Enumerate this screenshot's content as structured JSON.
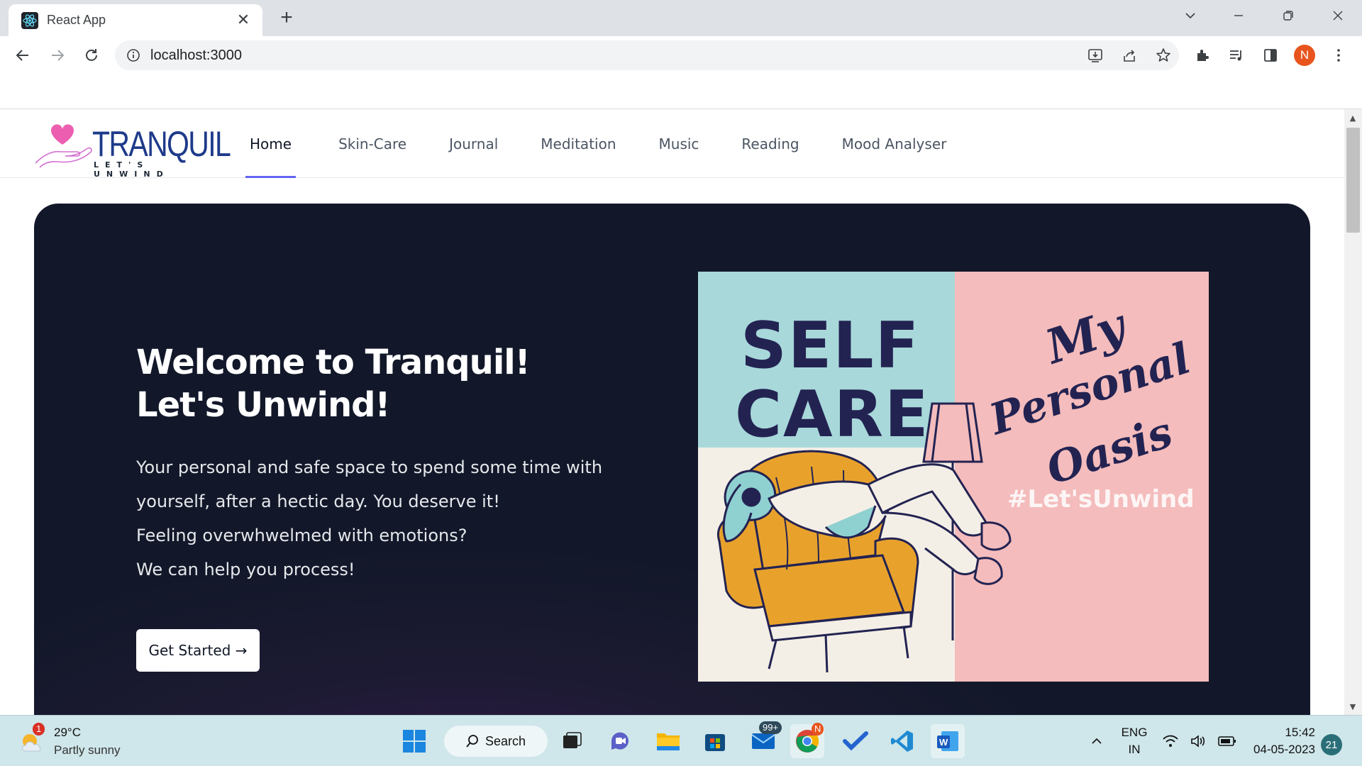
{
  "browser": {
    "tab_title": "React App",
    "url": "localhost:3000",
    "profile_initial": "N"
  },
  "site": {
    "logo_word": "TRANQUIL",
    "logo_tagline": "LET'S UNWIND",
    "nav": [
      {
        "label": "Home",
        "active": true
      },
      {
        "label": "Skin-Care"
      },
      {
        "label": "Journal"
      },
      {
        "label": "Meditation"
      },
      {
        "label": "Music"
      },
      {
        "label": "Reading"
      },
      {
        "label": "Mood Analyser"
      }
    ]
  },
  "hero": {
    "title_line1": "Welcome to Tranquil!",
    "title_line2": "Let's Unwind!",
    "copy": [
      "Your personal and safe space to spend some time with",
      "yourself, after a hectic day. You deserve it!",
      "Feeling overwhwelmed with emotions?",
      "We can help you process!"
    ],
    "cta_label": "Get Started →",
    "image": {
      "self": "SELF",
      "care": "CARE",
      "script_line1": "My",
      "script_line2": "Personal",
      "script_line3": "Oasis",
      "hashtag": "#Let'sUnwind",
      "colors": {
        "teal": "#a8d8da",
        "pink": "#f4bcbc",
        "cream": "#f4efe6",
        "navy": "#232352",
        "mustard": "#e8a22c"
      }
    }
  },
  "taskbar": {
    "weather_temp": "29°C",
    "weather_condition": "Partly sunny",
    "weather_badge": "1",
    "search_label": "Search",
    "mail_badge": "99+",
    "chrome_badge": "N",
    "lang_line1": "ENG",
    "lang_line2": "IN",
    "time": "15:42",
    "date": "04-05-2023",
    "notification_count": "21"
  },
  "colors": {
    "accent": "#6366f1",
    "hero_bg": "#121829",
    "logo_blue": "#1e3a8a",
    "logo_pink": "#ec4899"
  }
}
